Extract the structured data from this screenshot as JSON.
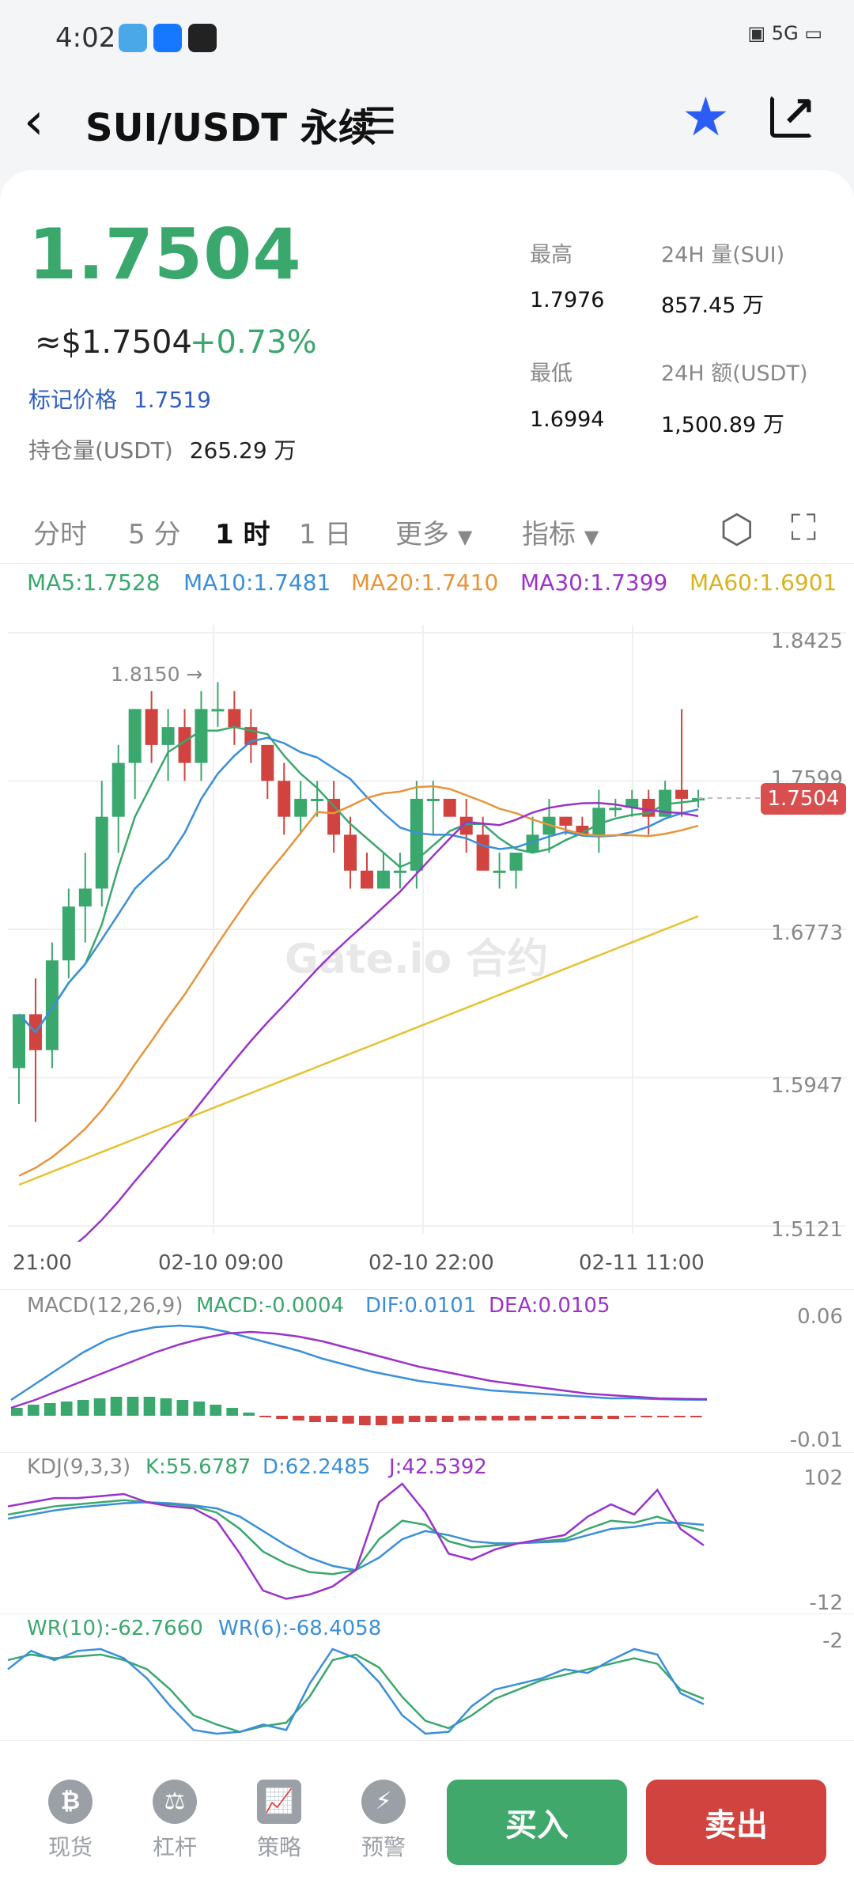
{
  "status": {
    "time": "4:02",
    "network": "5G"
  },
  "header": {
    "title": "SUI/USDT 永续",
    "menu_icon": "menu-icon"
  },
  "ticker": {
    "last_price": "1.7504",
    "approx_usd": "≈$1.7504",
    "change_pct": "+0.73%",
    "mark_label": "标记价格",
    "mark_price": "1.7519",
    "hold_label": "持仓量(USDT)",
    "hold_value": "265.29 万",
    "high_label": "最高",
    "high_value": "1.7976",
    "vol_label": "24H 量(SUI)",
    "vol_value": "857.45 万",
    "low_label": "最低",
    "low_value": "1.6994",
    "amt_label": "24H 额(USDT)",
    "amt_value": "1,500.89 万"
  },
  "tabs": [
    {
      "label": "分时"
    },
    {
      "label": "5 分"
    },
    {
      "label": "1 时"
    },
    {
      "label": "1 日"
    },
    {
      "label": "更多"
    },
    {
      "label": "指标"
    }
  ],
  "ma": {
    "ma5": "MA5:1.7528",
    "ma10": "MA10:1.7481",
    "ma20": "MA20:1.7410",
    "ma30": "MA30:1.7399",
    "ma60": "MA60:1.6901"
  },
  "colors": {
    "up": "#3aa76d",
    "down": "#d0433f",
    "ma5": "#3aa76d",
    "ma10": "#3b8fd8",
    "ma20": "#e8943a",
    "ma30": "#9b33c9",
    "ma60": "#e6c230"
  },
  "chart_data": {
    "type": "candlestick",
    "yticks": [
      "1.8425",
      "1.7599",
      "1.6773",
      "1.5947",
      "1.5121"
    ],
    "ylim": [
      1.5121,
      1.8425
    ],
    "xticks": [
      "21:00",
      "02-10 09:00",
      "02-10 22:00",
      "02-11 11:00"
    ],
    "high_annotation": "1.8150 →",
    "last_price_tag": "1.7504",
    "candles": [
      [
        1.6,
        1.63,
        1.58,
        1.63
      ],
      [
        1.63,
        1.61,
        1.57,
        1.65
      ],
      [
        1.61,
        1.66,
        1.6,
        1.67
      ],
      [
        1.66,
        1.69,
        1.65,
        1.7
      ],
      [
        1.69,
        1.7,
        1.67,
        1.72
      ],
      [
        1.7,
        1.74,
        1.69,
        1.76
      ],
      [
        1.74,
        1.77,
        1.72,
        1.78
      ],
      [
        1.77,
        1.8,
        1.75,
        1.8
      ],
      [
        1.8,
        1.78,
        1.77,
        1.81
      ],
      [
        1.78,
        1.79,
        1.76,
        1.8
      ],
      [
        1.79,
        1.77,
        1.76,
        1.8
      ],
      [
        1.77,
        1.8,
        1.76,
        1.81
      ],
      [
        1.8,
        1.8,
        1.79,
        1.815
      ],
      [
        1.8,
        1.79,
        1.78,
        1.81
      ],
      [
        1.79,
        1.78,
        1.77,
        1.8
      ],
      [
        1.78,
        1.76,
        1.75,
        1.78
      ],
      [
        1.76,
        1.74,
        1.73,
        1.77
      ],
      [
        1.74,
        1.75,
        1.73,
        1.76
      ],
      [
        1.75,
        1.75,
        1.74,
        1.76
      ],
      [
        1.75,
        1.73,
        1.72,
        1.76
      ],
      [
        1.73,
        1.71,
        1.7,
        1.74
      ],
      [
        1.71,
        1.7,
        1.7,
        1.72
      ],
      [
        1.7,
        1.71,
        1.7,
        1.72
      ],
      [
        1.71,
        1.71,
        1.7,
        1.72
      ],
      [
        1.71,
        1.75,
        1.7,
        1.76
      ],
      [
        1.75,
        1.75,
        1.73,
        1.76
      ],
      [
        1.75,
        1.74,
        1.74,
        1.75
      ],
      [
        1.74,
        1.73,
        1.72,
        1.75
      ],
      [
        1.73,
        1.71,
        1.71,
        1.74
      ],
      [
        1.71,
        1.71,
        1.7,
        1.72
      ],
      [
        1.71,
        1.72,
        1.7,
        1.72
      ],
      [
        1.72,
        1.73,
        1.72,
        1.74
      ],
      [
        1.73,
        1.74,
        1.72,
        1.75
      ],
      [
        1.74,
        1.735,
        1.73,
        1.74
      ],
      [
        1.735,
        1.73,
        1.73,
        1.74
      ],
      [
        1.73,
        1.745,
        1.72,
        1.755
      ],
      [
        1.745,
        1.745,
        1.74,
        1.75
      ],
      [
        1.745,
        1.75,
        1.74,
        1.755
      ],
      [
        1.75,
        1.74,
        1.73,
        1.755
      ],
      [
        1.74,
        1.755,
        1.74,
        1.76
      ],
      [
        1.755,
        1.75,
        1.74,
        1.8
      ],
      [
        1.75,
        1.7504,
        1.745,
        1.755
      ]
    ]
  },
  "macd": {
    "label": "MACD(12,26,9)",
    "macd": "MACD:-0.0004",
    "dif": "DIF:0.0101",
    "dea": "DEA:0.0105",
    "ymax": "0.06",
    "ymin": "-0.01",
    "hist": [
      0.005,
      0.007,
      0.008,
      0.009,
      0.01,
      0.011,
      0.012,
      0.012,
      0.012,
      0.011,
      0.01,
      0.009,
      0.007,
      0.005,
      0.002,
      -0.001,
      -0.002,
      -0.003,
      -0.004,
      -0.004,
      -0.005,
      -0.006,
      -0.006,
      -0.005,
      -0.004,
      -0.004,
      -0.004,
      -0.003,
      -0.003,
      -0.003,
      -0.003,
      -0.003,
      -0.002,
      -0.002,
      -0.002,
      -0.002,
      -0.002,
      -0.001,
      -0.001,
      -0.001,
      -0.0005,
      -0.0004
    ],
    "dif_line": [
      0.01,
      0.02,
      0.03,
      0.04,
      0.048,
      0.053,
      0.056,
      0.057,
      0.056,
      0.053,
      0.049,
      0.045,
      0.041,
      0.036,
      0.032,
      0.028,
      0.025,
      0.022,
      0.02,
      0.018,
      0.016,
      0.015,
      0.014,
      0.013,
      0.012,
      0.011,
      0.011,
      0.0105,
      0.0102,
      0.0101
    ],
    "dea_line": [
      0.005,
      0.01,
      0.016,
      0.022,
      0.028,
      0.034,
      0.04,
      0.045,
      0.049,
      0.052,
      0.053,
      0.052,
      0.05,
      0.047,
      0.043,
      0.039,
      0.035,
      0.031,
      0.028,
      0.025,
      0.022,
      0.02,
      0.018,
      0.016,
      0.014,
      0.013,
      0.012,
      0.011,
      0.0107,
      0.0105
    ]
  },
  "kdj": {
    "label": "KDJ(9,3,3)",
    "k": "K:55.6787",
    "d": "D:62.2485",
    "j": "J:42.5392",
    "ymax": "102",
    "ymin": "-12",
    "k_line": [
      72,
      76,
      80,
      82,
      84,
      86,
      84,
      82,
      80,
      74,
      58,
      36,
      24,
      16,
      14,
      18,
      48,
      66,
      62,
      46,
      40,
      42,
      44,
      46,
      48,
      58,
      66,
      64,
      70,
      62,
      56
    ],
    "d_line": [
      68,
      72,
      76,
      79,
      81,
      83,
      84,
      83,
      81,
      78,
      70,
      56,
      42,
      30,
      22,
      18,
      30,
      48,
      56,
      52,
      46,
      44,
      44,
      45,
      46,
      52,
      58,
      60,
      64,
      64,
      62
    ],
    "j_line": [
      80,
      84,
      88,
      88,
      90,
      92,
      84,
      80,
      78,
      66,
      34,
      -2,
      -10,
      -6,
      2,
      18,
      84,
      102,
      74,
      34,
      28,
      38,
      44,
      48,
      52,
      70,
      82,
      72,
      96,
      58,
      42
    ]
  },
  "wr": {
    "label_wr10": "WR(10):-62.7660",
    "label_wr6": "WR(6):-68.4058",
    "ymax": "-2",
    "wr10_line": [
      -20,
      -14,
      -18,
      -16,
      -14,
      -20,
      -30,
      -52,
      -80,
      -90,
      -98,
      -92,
      -88,
      -60,
      -20,
      -14,
      -28,
      -60,
      -86,
      -94,
      -80,
      -62,
      -52,
      -42,
      -36,
      -30,
      -24,
      -18,
      -24,
      -52,
      -62
    ],
    "wr6_line": [
      -30,
      -10,
      -20,
      -10,
      -8,
      -18,
      -40,
      -70,
      -96,
      -100,
      -98,
      -90,
      -96,
      -46,
      -8,
      -18,
      -44,
      -80,
      -100,
      -98,
      -70,
      -52,
      -46,
      -40,
      -30,
      -34,
      -20,
      -8,
      -14,
      -56,
      -68
    ]
  },
  "bottom_nav": [
    {
      "label": "现货",
      "icon": "bitcoin-icon"
    },
    {
      "label": "杠杆",
      "icon": "lever-icon"
    },
    {
      "label": "策略",
      "icon": "chart-icon"
    },
    {
      "label": "预警",
      "icon": "alert-icon"
    }
  ],
  "actions": {
    "buy": "买入",
    "sell": "卖出"
  },
  "watermark": "Gate.io 合约"
}
